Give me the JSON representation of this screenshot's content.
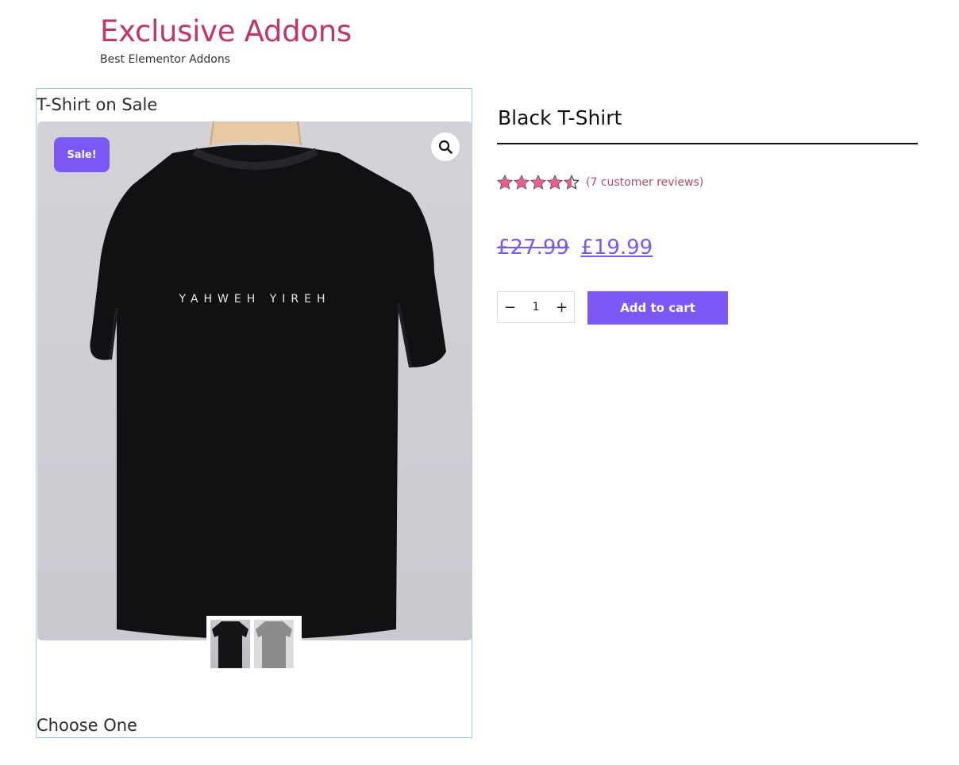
{
  "site": {
    "title": "Exclusive Addons",
    "tagline": "Best Elementor Addons",
    "brand_color": "#c2346b"
  },
  "gallery": {
    "heading": "T-Shirt on Sale",
    "sale_badge": "Sale!",
    "shirt_print": "YAHWEH YIREH",
    "zoom_icon": "search-icon",
    "thumbnails": [
      {
        "name": "black-tshirt"
      },
      {
        "name": "grey-tshirt"
      }
    ],
    "footer_heading": "Choose One"
  },
  "product": {
    "title": "Black T-Shirt",
    "rating": 4.5,
    "rating_max": 5,
    "review_text": "(7 customer reviews)",
    "price_old": "£27.99",
    "price_new": "£19.99",
    "quantity": "1",
    "add_to_cart_label": "Add to cart",
    "accent_color": "#7b57f5",
    "star_color": "#f05c8c"
  }
}
